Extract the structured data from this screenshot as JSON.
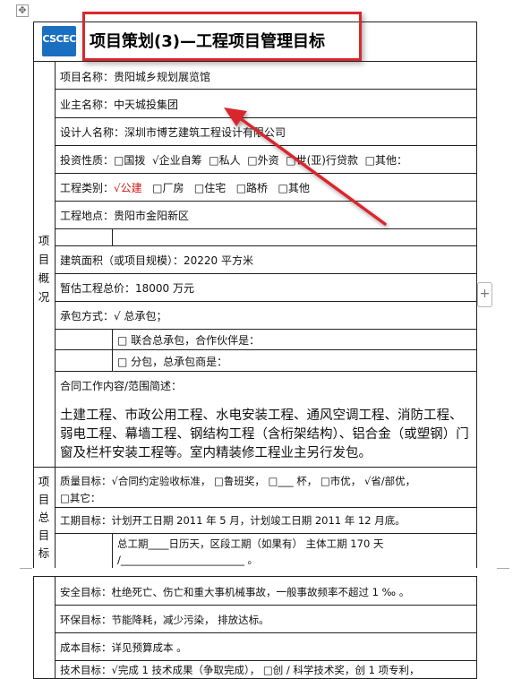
{
  "title": "项目策划(3)—工程项目管理目标",
  "logo_text": "CSCEC",
  "sections": {
    "overview_label": [
      "项",
      "目",
      "概",
      "况"
    ],
    "goals_label": [
      "项",
      "目",
      "总",
      "目",
      "标"
    ]
  },
  "overview": {
    "project_name": "项目名称：贵阳城乡规划展览馆",
    "owner_name": "业主名称：中天城投集团",
    "designer_name": "设计人名称：深圳市博艺建筑工程设计有限公司",
    "investment_nature": {
      "label": "投资性质：",
      "options": [
        "□国拨",
        "√企业自筹",
        "□私人",
        "□外资",
        "□世(亚)行贷款",
        "□其他："
      ],
      "selected": "企业自筹"
    },
    "project_type": {
      "label": "工程类别：",
      "options": [
        "√公建",
        "□厂房",
        "□住宅",
        "□路桥",
        "□其他"
      ],
      "selected": "公建"
    },
    "location": "工程地点：贵阳市金阳新区",
    "building_area": "建筑面积（或项目规模）：20220 平方米",
    "estimated_cost": "暂估工程总价：18000 万元",
    "contract_mode": "承包方式：√ 总承包；",
    "joint_contract": "□ 联合总承包，合作伙伴是：",
    "subcontract": "□ 分包，总承包商是：",
    "scope_label": "合同工作内容/范围简述：",
    "scope_text": "土建工程、市政公用工程、水电安装工程、通风空调工程、消防工程、弱电工程、幕墙工程、钢结构工程（含桁架结构）、铝合金（或塑钢）门窗及栏杆安装工程等。室内精装修工程业主另行发包。"
  },
  "goals": {
    "quality_line1": "质量目标：√合同约定验收标准，  □鲁班奖，    □___  杯，  □市优，  √省/部优，",
    "quality_line2": "□其它：",
    "schedule_line": "工期目标：计划开工日期  2011 年 5 月，计划竣工日期 2011 年 12 月底。",
    "duration_line1": "总工期____日历天，区段工期（如果有） 主体工期 170 天",
    "duration_line2": "/________________________ 。",
    "safety": "安全目标：杜绝死亡、伤亡和重大事机械事故，一般事故频率不超过 1 ‰ 。",
    "environment": "环保目标：节能降耗，减少污染，  排放达标。",
    "cost": "成本目标：详见预算成本 。",
    "technology": "技术目标：√完成 1 技术成果（争取完成），  □创    /   科学技术奖，创 1 项专利，"
  },
  "colors": {
    "highlight_red": "#d9272e",
    "logo_blue": "#1a6fc0",
    "checked_red": "#d01818"
  }
}
